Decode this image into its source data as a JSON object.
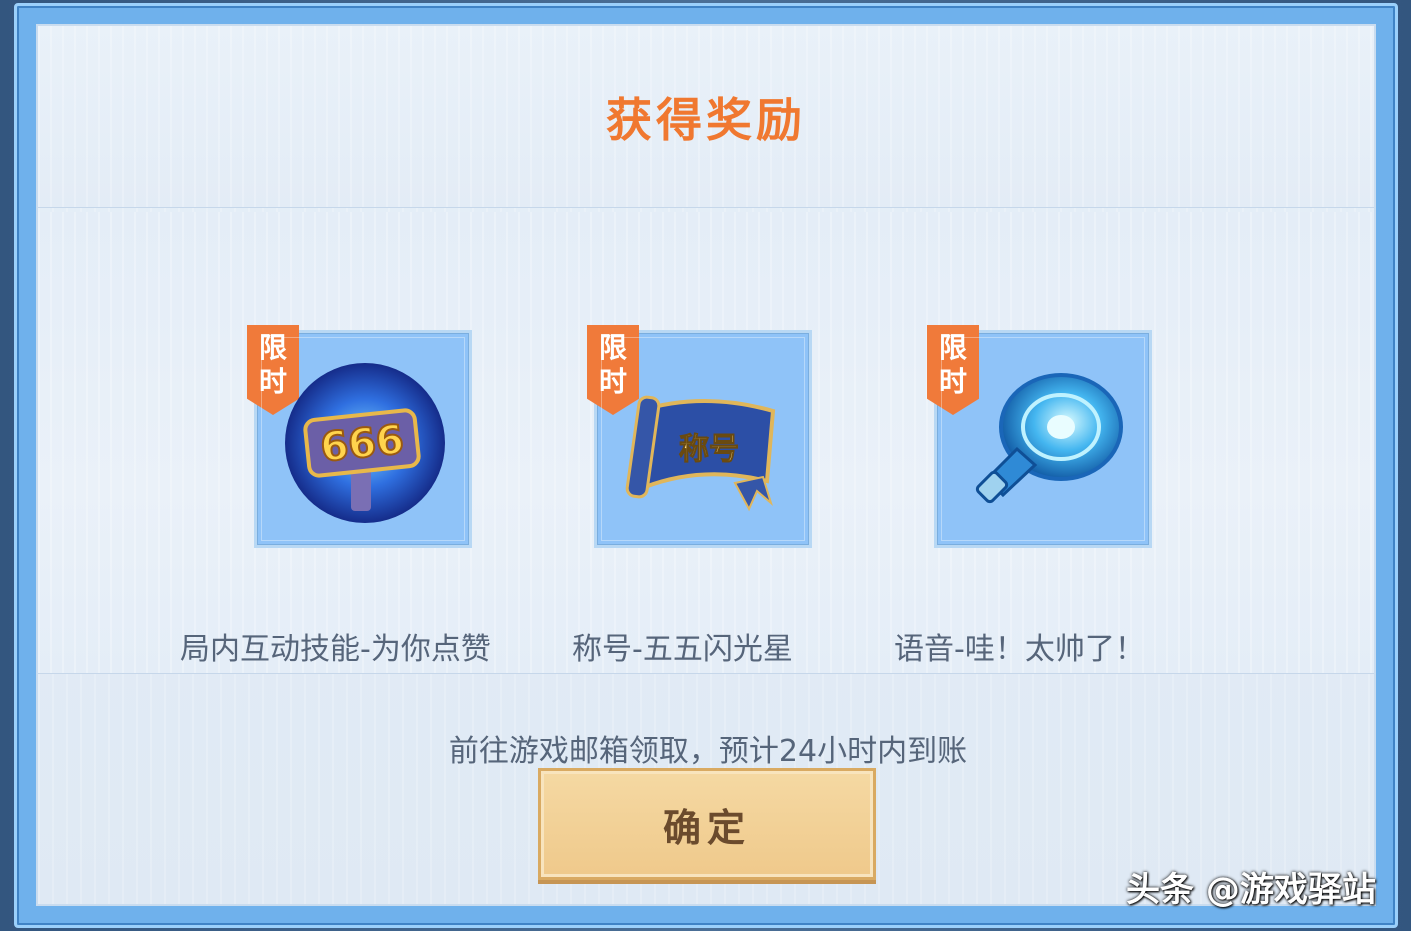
{
  "dialog": {
    "title": "获得奖励",
    "rewards": [
      {
        "tag": [
          "限",
          "时"
        ],
        "icon": "666-thumbs-up-hammer-icon",
        "name": "局内互动技能-为你点赞"
      },
      {
        "tag": [
          "限",
          "时"
        ],
        "icon": "title-scroll-icon",
        "scroll_text": "称号",
        "name": "称号-五五闪光星"
      },
      {
        "tag": [
          "限",
          "时"
        ],
        "icon": "speaker-horn-icon",
        "name": "语音-哇！太帅了！"
      }
    ],
    "notice": "前往游戏邮箱领取，预计24小时内到账",
    "confirm_label": "确定"
  },
  "watermark": "头条 @游戏驿站",
  "colors": {
    "title": "#f07830",
    "tag": "#f07a3a",
    "card_bg": "#8fc3f8",
    "button_bg": "#efc98b",
    "frame": "#6fb1ec"
  }
}
